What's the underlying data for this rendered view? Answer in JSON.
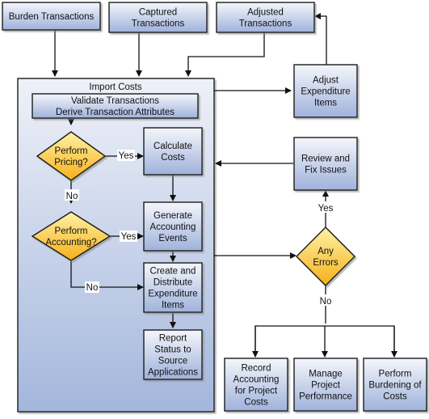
{
  "colors": {
    "box_top": "#f4f6fb",
    "box_bottom": "#9fb2db",
    "container_top": "#eef1f8",
    "container_bottom": "#a3b6dc",
    "diamond_top": "#fff1a6",
    "diamond_bottom": "#f5b01a",
    "line": "#111111"
  },
  "nodes": {
    "burden_transactions": [
      "Burden Transactions"
    ],
    "captured_transactions": [
      "Captured",
      "Transactions"
    ],
    "adjusted_transactions": [
      "Adjusted",
      "Transactions"
    ],
    "import_costs": [
      "Import Costs"
    ],
    "validate": [
      "Validate Transactions",
      "Derive Transaction Attributes"
    ],
    "perform_pricing": [
      "Perform",
      "Pricing?"
    ],
    "calculate_costs": [
      "Calculate",
      "Costs"
    ],
    "perform_accounting": [
      "Perform",
      "Accounting?"
    ],
    "generate_accounting_events": [
      "Generate",
      "Accounting",
      "Events"
    ],
    "create_distribute": [
      "Create and",
      "Distribute",
      "Expenditure",
      "Items"
    ],
    "report_status": [
      "Report",
      "Status to",
      "Source",
      "Applications"
    ],
    "adjust_expenditure_items": [
      "Adjust",
      "Expenditure",
      "Items"
    ],
    "review_fix_issues": [
      "Review and",
      "Fix Issues"
    ],
    "any_errors": [
      "Any",
      "Errors"
    ],
    "record_accounting": [
      "Record",
      "Accounting",
      "for Project",
      "Costs"
    ],
    "manage_project_performance": [
      "Manage",
      "Project",
      "Performance"
    ],
    "perform_burdening": [
      "Perform",
      "Burdening of",
      "Costs"
    ]
  },
  "edge_labels": {
    "pricing_yes": "Yes",
    "pricing_no": "No",
    "accounting_yes": "Yes",
    "accounting_no": "No",
    "errors_yes": "Yes",
    "errors_no": "No"
  }
}
